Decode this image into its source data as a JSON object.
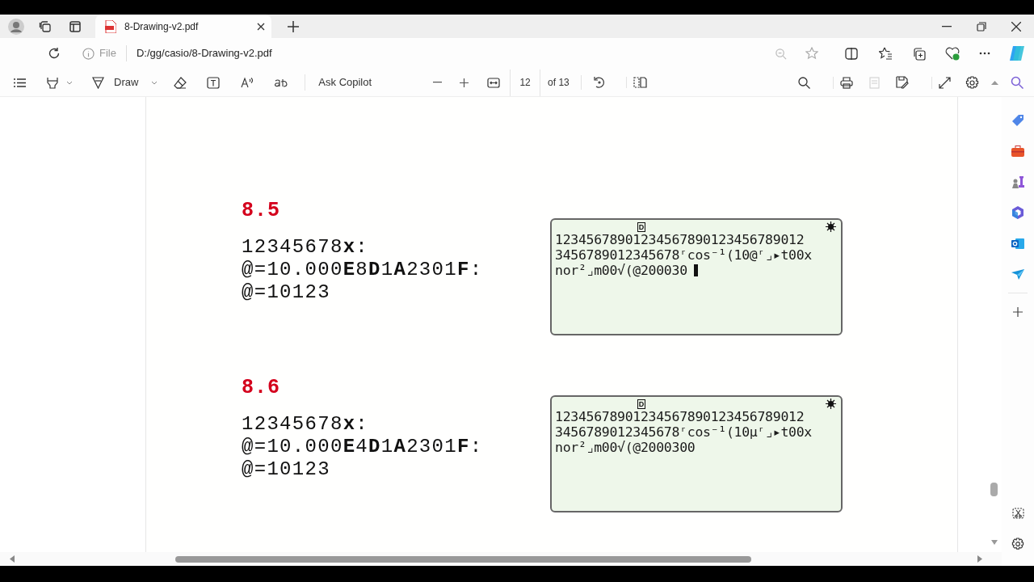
{
  "tab": {
    "title": "8-Drawing-v2.pdf",
    "selected": true
  },
  "address_bar": {
    "scheme_label": "File",
    "url": "D:/gg/casio/8-Drawing-v2.pdf"
  },
  "pdf_toolbar": {
    "draw_label": "Draw",
    "ask_label": "Ask Copilot",
    "page_number": "12",
    "page_count": "of 13"
  },
  "sections": [
    {
      "heading": "8.5",
      "lines": [
        "12345678**x**:",
        "@=10.000**E**8**D**1**A**2301**F**:",
        "@=10123"
      ],
      "screen": {
        "indicator": "D",
        "lines": [
          "12345678901234567890123456789012",
          "3456789012345678ʳcos⁻¹(10@ʳ⌟▸t00x",
          "nor²⌟m00√(@200030"
        ],
        "cursor": true
      }
    },
    {
      "heading": "8.6",
      "lines": [
        "12345678**x**:",
        "@=10.000**E**4**D**1**A**2301**F**:",
        "@=10123"
      ],
      "screen": {
        "indicator": "D",
        "lines": [
          "12345678901234567890123456789012",
          "3456789012345678ʳcos⁻¹(10µʳ⌟▸t00x",
          "nor²⌟m00√(@2000300"
        ],
        "cursor": false
      }
    }
  ]
}
